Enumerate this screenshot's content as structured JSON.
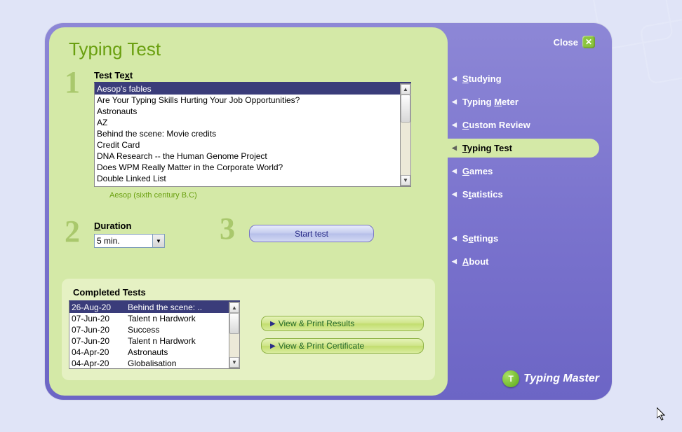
{
  "page": {
    "title": "Typing Test"
  },
  "close": {
    "label": "Close"
  },
  "sidebar": {
    "items": [
      {
        "pre": "",
        "u": "S",
        "post": "tudying",
        "selected": false
      },
      {
        "pre": "Typing ",
        "u": "M",
        "post": "eter",
        "selected": false
      },
      {
        "pre": "",
        "u": "C",
        "post": "ustom Review",
        "selected": false
      },
      {
        "pre": "",
        "u": "T",
        "post": "yping Test",
        "selected": true
      },
      {
        "pre": "",
        "u": "G",
        "post": "ames",
        "selected": false
      },
      {
        "pre": "S",
        "u": "t",
        "post": "atistics",
        "selected": false
      },
      {
        "pre": "S",
        "u": "e",
        "post": "ttings",
        "selected": false
      },
      {
        "pre": "",
        "u": "A",
        "post": "bout",
        "selected": false
      }
    ]
  },
  "step1": {
    "label_pre": "Test Te",
    "label_u": "x",
    "label_post": "t",
    "items": [
      "Aesop's fables",
      "Are Your Typing Skills Hurting Your Job Opportunities?",
      "Astronauts",
      "AZ",
      "Behind the scene: Movie credits",
      "Credit Card",
      "DNA Research -- the Human Genome Project",
      "Does WPM Really Matter in the Corporate World?",
      "Double Linked List"
    ],
    "selected_index": 0,
    "caption": "Aesop (sixth century B.C)"
  },
  "step2": {
    "label_pre": "",
    "label_u": "D",
    "label_post": "uration",
    "value": "5 min."
  },
  "step3": {
    "button": "Start test"
  },
  "completed": {
    "label": "Completed Tests",
    "items": [
      {
        "date": "26-Aug-20",
        "title": "Behind the scene: ..",
        "selected": true
      },
      {
        "date": "07-Jun-20",
        "title": "Talent n Hardwork",
        "selected": false
      },
      {
        "date": "07-Jun-20",
        "title": "Success",
        "selected": false
      },
      {
        "date": "07-Jun-20",
        "title": "Talent n Hardwork",
        "selected": false
      },
      {
        "date": "04-Apr-20",
        "title": "Astronauts",
        "selected": false
      },
      {
        "date": "04-Apr-20",
        "title": "Globalisation",
        "selected": false
      }
    ],
    "actions": {
      "results": "View & Print Results",
      "certificate": "View & Print Certificate"
    }
  },
  "logo": {
    "text": "Typing Master",
    "mark": "T"
  },
  "step_numbers": {
    "s1": "1",
    "s2": "2",
    "s3": "3"
  }
}
